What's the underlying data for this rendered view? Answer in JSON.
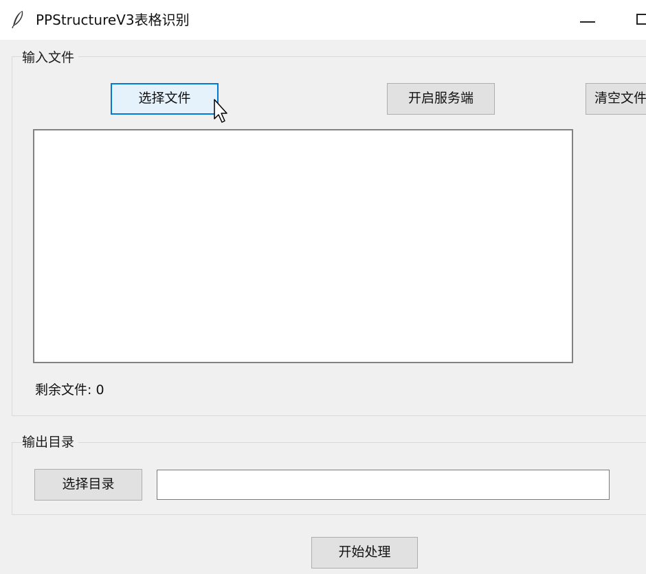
{
  "window": {
    "title": "PPStructureV3表格识别",
    "icon": "feather-icon",
    "controls": [
      "minimize-icon",
      "maximize-icon"
    ]
  },
  "input_group": {
    "title": "输入文件",
    "buttons": {
      "select_file": "选择文件",
      "start_server": "开启服务端",
      "clear_files": "清空文件"
    },
    "file_list": [],
    "remaining_label": "剩余文件: 0"
  },
  "output_group": {
    "title": "输出目录",
    "select_dir_label": "选择目录",
    "dir_value": ""
  },
  "actions": {
    "start_label": "开始处理"
  },
  "colors": {
    "background": "#f0f0f0",
    "focus_border": "#0078d7",
    "focus_fill": "#e5f1fb",
    "button_fill": "#e1e1e1"
  }
}
